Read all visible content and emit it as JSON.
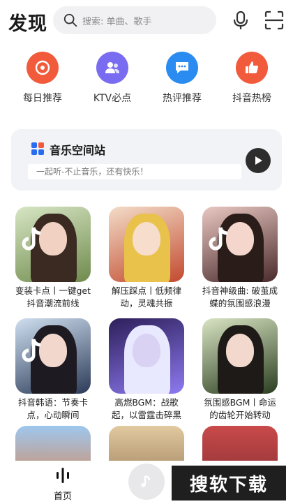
{
  "header": {
    "title": "发现",
    "search_placeholder": "搜索: 单曲、歌手",
    "mic_icon": "mic-icon",
    "scan_icon": "scan-icon"
  },
  "quick_entries": [
    {
      "label": "每日推荐",
      "icon": "daily-disc-icon",
      "color": "#f25a3c"
    },
    {
      "label": "KTV必点",
      "icon": "ktv-users-icon",
      "color": "#7a6cf0"
    },
    {
      "label": "热评推荐",
      "icon": "comment-bubble-icon",
      "color": "#2a8cf0"
    },
    {
      "label": "抖音热榜",
      "icon": "thumbs-up-icon",
      "color": "#f25a3c"
    }
  ],
  "banner": {
    "title": "音乐空间站",
    "subtitle": "一起听-不止音乐，还有快乐！",
    "play_icon": "play-icon"
  },
  "playlists": [
    {
      "line1": "变装卡点丨一键get",
      "line2": "抖音潮流前线",
      "colors": [
        "#d7e6c4",
        "#6f8a4c"
      ]
    },
    {
      "line1": "解压踩点丨低频律",
      "line2": "动，灵魂共振",
      "colors": [
        "#f3dcc8",
        "#c24a2f"
      ]
    },
    {
      "line1": "抖音神级曲: 破茧成",
      "line2": "蝶的氛围感浪漫",
      "colors": [
        "#e9c7c2",
        "#4a2b2b"
      ]
    },
    {
      "line1": "抖音韩语：节奏卡",
      "line2": "点，心动瞬间",
      "colors": [
        "#cfdff0",
        "#2b3a57"
      ]
    },
    {
      "line1": "高燃BGM：战歌",
      "line2": "起，以雷霆击碎黑",
      "colors": [
        "#2d1f5a",
        "#8e7af0"
      ]
    },
    {
      "line1": "氛围感BGM丨命运",
      "line2": "的齿轮开始转动",
      "colors": [
        "#d9e4c4",
        "#2a3e1f"
      ]
    },
    {
      "line1": "",
      "line2": "",
      "colors": [
        "#9ec7ee",
        "#e07a3a"
      ]
    },
    {
      "line1": "",
      "line2": "",
      "colors": [
        "#e3c9a0",
        "#8a6e4a"
      ]
    },
    {
      "line1": "",
      "line2": "",
      "colors": [
        "#c94a4a",
        "#7a2a30"
      ]
    }
  ],
  "tabbar": {
    "home_label": "首页",
    "home_icon": "soundwave-icon",
    "center_icon": "music-note-icon"
  },
  "watermark": "搜软下载"
}
